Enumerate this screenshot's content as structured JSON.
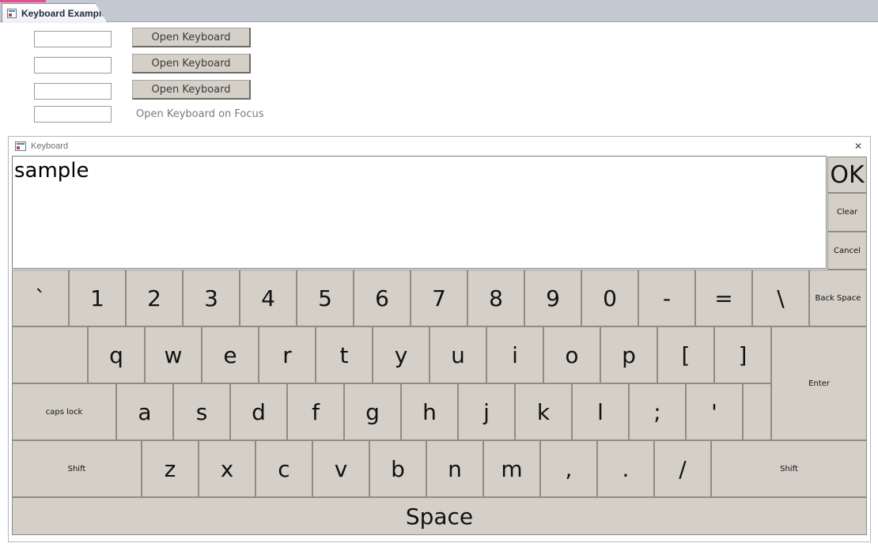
{
  "tab": {
    "title": "Keyboard Example",
    "icon": "form-icon"
  },
  "form": {
    "open_buttons": [
      "Open Keyboard",
      "Open Keyboard",
      "Open Keyboard"
    ],
    "focus_label": "Open Keyboard on Focus",
    "inputs": [
      "",
      "",
      "",
      ""
    ]
  },
  "keyboard": {
    "title": "Keyboard",
    "display_text": "sample",
    "side": {
      "ok": "OK",
      "clear": "Clear",
      "cancel": "Cancel"
    },
    "row1": [
      "`",
      "1",
      "2",
      "3",
      "4",
      "5",
      "6",
      "7",
      "8",
      "9",
      "0",
      "-",
      "=",
      "\\",
      "Back Space"
    ],
    "row2": [
      "",
      "q",
      "w",
      "e",
      "r",
      "t",
      "y",
      "u",
      "i",
      "o",
      "p",
      "[",
      "]"
    ],
    "enter": "Enter",
    "row3": [
      "caps lock",
      "a",
      "s",
      "d",
      "f",
      "g",
      "h",
      "j",
      "k",
      "l",
      ";",
      "'",
      ""
    ],
    "row4": [
      "Shift",
      "z",
      "x",
      "c",
      "v",
      "b",
      "n",
      "m",
      ",",
      ".",
      "/",
      "Shift"
    ],
    "space": "Space"
  },
  "colors": {
    "key_face": "#d4d0c8",
    "tab_accent": "#e0508c",
    "strip": "#c3c8d1"
  }
}
